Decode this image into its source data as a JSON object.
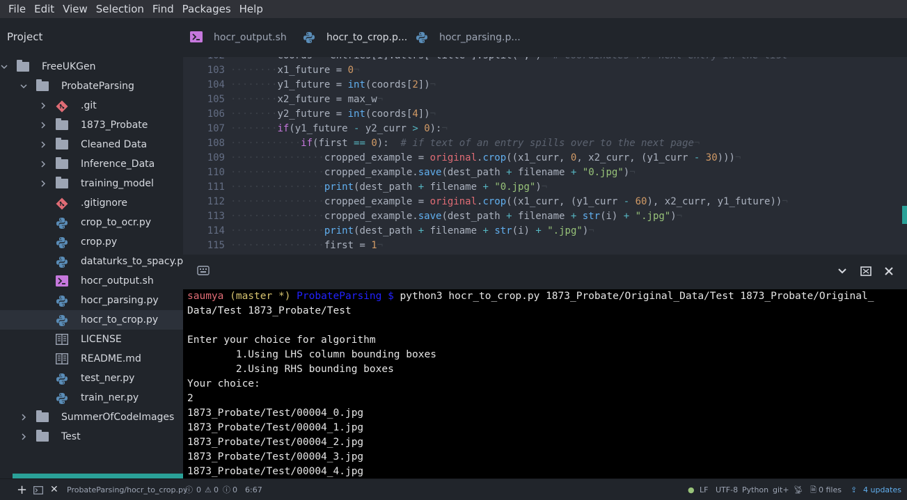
{
  "menu": [
    "File",
    "Edit",
    "View",
    "Selection",
    "Find",
    "Packages",
    "Help"
  ],
  "project_title": "Project",
  "tabs": [
    {
      "label": "hocr_output.sh",
      "icon": "terminal-icon",
      "active": false
    },
    {
      "label": "hocr_to_crop.p...",
      "icon": "python-icon",
      "active": true
    },
    {
      "label": "hocr_parsing.p...",
      "icon": "python-icon",
      "active": false
    }
  ],
  "tree": [
    {
      "label": "FreeUKGen",
      "type": "folder",
      "expanded": true
    },
    {
      "label": "ProbateParsing",
      "type": "folder",
      "expanded": true
    },
    {
      "label": ".git",
      "type": "git",
      "expanded": false
    },
    {
      "label": "1873_Probate",
      "type": "folder",
      "expanded": false
    },
    {
      "label": "Cleaned Data",
      "type": "folder",
      "expanded": false
    },
    {
      "label": "Inference_Data",
      "type": "folder",
      "expanded": false
    },
    {
      "label": "training_model",
      "type": "folder",
      "expanded": false
    },
    {
      "label": ".gitignore",
      "type": "git"
    },
    {
      "label": "crop_to_ocr.py",
      "type": "python"
    },
    {
      "label": "crop.py",
      "type": "python"
    },
    {
      "label": "dataturks_to_spacy.py",
      "type": "python"
    },
    {
      "label": "hocr_output.sh",
      "type": "shell"
    },
    {
      "label": "hocr_parsing.py",
      "type": "python"
    },
    {
      "label": "hocr_to_crop.py",
      "type": "python",
      "selected": true
    },
    {
      "label": "LICENSE",
      "type": "book"
    },
    {
      "label": "README.md",
      "type": "book"
    },
    {
      "label": "test_ner.py",
      "type": "python"
    },
    {
      "label": "train_ner.py",
      "type": "python"
    },
    {
      "label": "SummerOfCodeImages",
      "type": "folder",
      "expanded": false
    },
    {
      "label": "Test",
      "type": "folder",
      "expanded": false
    }
  ],
  "code_lines": [
    {
      "n": "102",
      "ind": 2,
      "tokens": [
        [
          "",
          "coords = entries[i].attrs['title'].split(';')"
        ],
        [
          "cmt",
          "  # coordinates for next entry in the list"
        ]
      ]
    },
    {
      "n": "103",
      "ind": 2,
      "tokens": [
        [
          "",
          "x1_future = "
        ],
        [
          "num",
          "0"
        ]
      ]
    },
    {
      "n": "104",
      "ind": 2,
      "tokens": [
        [
          "",
          "y1_future = "
        ],
        [
          "fn",
          "int"
        ],
        [
          "",
          "(coords["
        ],
        [
          "num",
          "2"
        ],
        [
          "",
          "])"
        ]
      ]
    },
    {
      "n": "105",
      "ind": 2,
      "tokens": [
        [
          "",
          "x2_future = max_w"
        ]
      ]
    },
    {
      "n": "106",
      "ind": 2,
      "tokens": [
        [
          "",
          "y2_future = "
        ],
        [
          "fn",
          "int"
        ],
        [
          "",
          "(coords["
        ],
        [
          "num",
          "4"
        ],
        [
          "",
          "])"
        ]
      ]
    },
    {
      "n": "107",
      "ind": 2,
      "tokens": [
        [
          "kw",
          "if"
        ],
        [
          "",
          "(y1_future "
        ],
        [
          "op",
          "-"
        ],
        [
          "",
          " y2_curr "
        ],
        [
          "op",
          ">"
        ],
        [
          "",
          " "
        ],
        [
          "num",
          "0"
        ],
        [
          "",
          "):"
        ]
      ]
    },
    {
      "n": "108",
      "ind": 3,
      "tokens": [
        [
          "kw",
          "if"
        ],
        [
          "",
          "(first "
        ],
        [
          "op",
          "=="
        ],
        [
          "",
          " "
        ],
        [
          "num",
          "0"
        ],
        [
          "",
          "):  "
        ],
        [
          "cmt",
          "# if text of an entry spills over to the next page"
        ]
      ]
    },
    {
      "n": "109",
      "ind": 4,
      "tokens": [
        [
          "",
          "cropped_example = "
        ],
        [
          "var",
          "original"
        ],
        [
          "",
          "."
        ],
        [
          "fn",
          "crop"
        ],
        [
          "",
          "((x1_curr, "
        ],
        [
          "num",
          "0"
        ],
        [
          "",
          ", x2_curr, (y1_curr "
        ],
        [
          "op",
          "-"
        ],
        [
          "",
          " "
        ],
        [
          "num",
          "30"
        ],
        [
          "",
          ")))"
        ]
      ]
    },
    {
      "n": "110",
      "ind": 4,
      "tokens": [
        [
          "",
          "cropped_example."
        ],
        [
          "fn",
          "save"
        ],
        [
          "",
          "(dest_path "
        ],
        [
          "op",
          "+"
        ],
        [
          "",
          " filename "
        ],
        [
          "op",
          "+"
        ],
        [
          "",
          " "
        ],
        [
          "str",
          "\"0.jpg\""
        ],
        [
          "",
          ")"
        ]
      ]
    },
    {
      "n": "111",
      "ind": 4,
      "tokens": [
        [
          "fn",
          "print"
        ],
        [
          "",
          "(dest_path "
        ],
        [
          "op",
          "+"
        ],
        [
          "",
          " filename "
        ],
        [
          "op",
          "+"
        ],
        [
          "",
          " "
        ],
        [
          "str",
          "\"0.jpg\""
        ],
        [
          "",
          ")"
        ]
      ]
    },
    {
      "n": "112",
      "ind": 4,
      "tokens": [
        [
          "",
          "cropped_example = "
        ],
        [
          "var",
          "original"
        ],
        [
          "",
          "."
        ],
        [
          "fn",
          "crop"
        ],
        [
          "",
          "((x1_curr, (y1_curr "
        ],
        [
          "op",
          "-"
        ],
        [
          "",
          " "
        ],
        [
          "num",
          "60"
        ],
        [
          "",
          "), x2_curr, y1_future))"
        ]
      ]
    },
    {
      "n": "113",
      "ind": 4,
      "tokens": [
        [
          "",
          "cropped_example."
        ],
        [
          "fn",
          "save"
        ],
        [
          "",
          "(dest_path "
        ],
        [
          "op",
          "+"
        ],
        [
          "",
          " filename "
        ],
        [
          "op",
          "+"
        ],
        [
          "",
          " "
        ],
        [
          "fn",
          "str"
        ],
        [
          "",
          "(i) "
        ],
        [
          "op",
          "+"
        ],
        [
          "",
          " "
        ],
        [
          "str",
          "\".jpg\""
        ],
        [
          "",
          ")"
        ]
      ]
    },
    {
      "n": "114",
      "ind": 4,
      "tokens": [
        [
          "fn",
          "print"
        ],
        [
          "",
          "(dest_path "
        ],
        [
          "op",
          "+"
        ],
        [
          "",
          " filename "
        ],
        [
          "op",
          "+"
        ],
        [
          "",
          " "
        ],
        [
          "fn",
          "str"
        ],
        [
          "",
          "(i) "
        ],
        [
          "op",
          "+"
        ],
        [
          "",
          " "
        ],
        [
          "str",
          "\".jpg\""
        ],
        [
          "",
          ")"
        ]
      ]
    },
    {
      "n": "115",
      "ind": 4,
      "tokens": [
        [
          "",
          "first = "
        ],
        [
          "num",
          "1"
        ]
      ]
    }
  ],
  "terminal": {
    "prompt_user": "saumya",
    "prompt_branch": " (master *)",
    "prompt_dir": " ProbateParsing $",
    "command": " python3 hocr_to_crop.py 1873_Probate/Original_Data/Test 1873_Probate/Original_",
    "lines": [
      "Data/Test 1873_Probate/Test",
      "",
      "Enter your choice for algorithm",
      "        1.Using LHS column bounding boxes",
      "        2.Using RHS bounding boxes",
      "Your choice:",
      "2",
      "1873_Probate/Test/00004_0.jpg",
      "1873_Probate/Test/00004_1.jpg",
      "1873_Probate/Test/00004_2.jpg",
      "1873_Probate/Test/00004_3.jpg",
      "1873_Probate/Test/00004_4.jpg"
    ]
  },
  "status": {
    "path": "ProbateParsing/hocr_to_crop.py",
    "errors": "0",
    "warnings": "0",
    "infos": "0",
    "cursor": "6:67",
    "line_ending": "LF",
    "encoding": "UTF-8",
    "grammar": "Python",
    "git": "git+",
    "files": "0 files",
    "updates": "4 updates"
  },
  "colors": {
    "accent": "#2aa198",
    "prompt_user": "#e06c75",
    "prompt_branch": "#d7c36f",
    "prompt_dir": "#1a1aff",
    "updates": "#61afef",
    "git_icon": "#e06c75",
    "python_icon": "#5a8db8",
    "shell_icon": "#c678dd"
  }
}
